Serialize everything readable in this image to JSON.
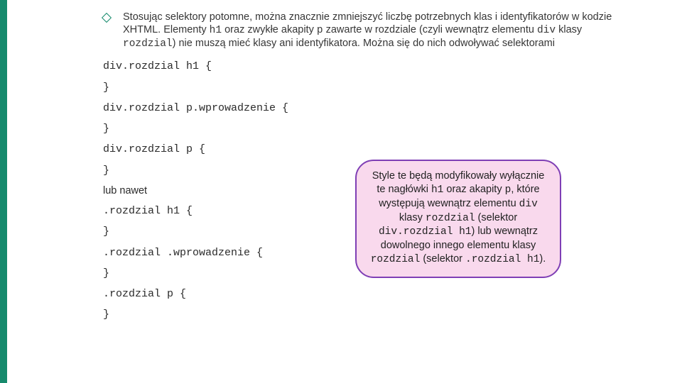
{
  "bullet": {
    "text_before_code1": "Stosując selektory potomne, można znacznie zmniejszyć liczbę potrzebnych klas i identyfikatorów w kodzie XHTML. Elementy ",
    "code1": "h1",
    "text_mid1": " oraz zwykłe akapity ",
    "code2": "p",
    "text_mid2": " zawarte w rozdziale (czyli wewnątrz elementu ",
    "code3": "div",
    "text_mid3": " klasy ",
    "code4": "rozdzial",
    "text_after": ") nie muszą mieć klasy ani identyfikatora. Można się do nich odwoływać selektorami"
  },
  "code_lines": [
    "div.rozdzial h1 {",
    "}",
    "div.rozdzial p.wprowadzenie {",
    "}",
    "div.rozdzial p {",
    "}",
    "lub nawet",
    ".rozdzial h1 {",
    "}",
    ".rozdzial .wprowadzenie {",
    "}",
    ".rozdzial p {",
    "}"
  ],
  "code_line_plain_index": 6,
  "callout": {
    "t1": "Style te będą modyfikowały wyłącznie te nagłówki ",
    "c1": "h1",
    "t2": " oraz akapity ",
    "c2": "p",
    "t3": ", które występują wewnątrz elementu ",
    "c3": "div",
    "t4": " klasy ",
    "c4": "rozdzial",
    "t5": " (selektor ",
    "c5": "div.rozdzial h1",
    "t6": ") lub wewnątrz dowolnego innego elementu klasy ",
    "c6": "rozdzial",
    "t7": " (selektor ",
    "c7": ".rozdzial h1",
    "t8": ")."
  }
}
